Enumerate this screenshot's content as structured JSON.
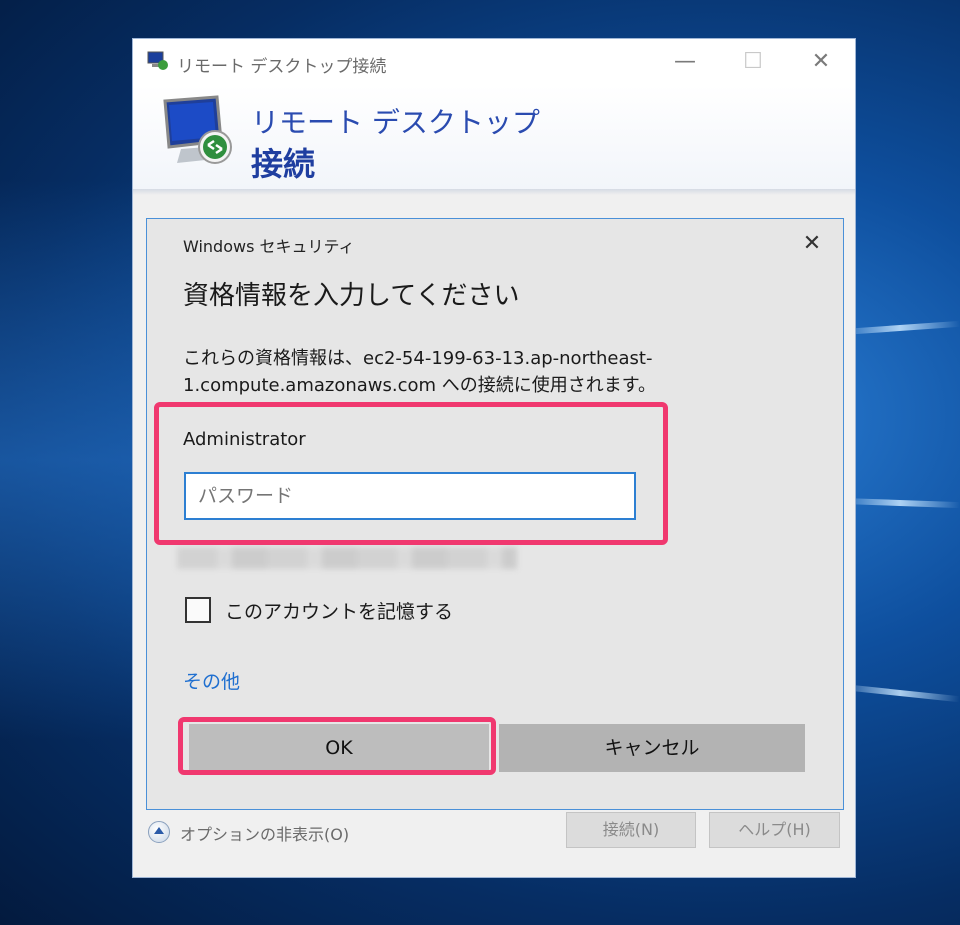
{
  "window": {
    "title": "リモート デスクトップ接続",
    "controls": {
      "minimize": "—",
      "maximize": "☐",
      "close": "✕"
    }
  },
  "banner": {
    "line1": "リモート デスクトップ",
    "line2": "接続"
  },
  "security_dialog": {
    "title": "Windows セキュリティ",
    "close": "✕",
    "heading": "資格情報を入力してください",
    "description": "これらの資格情報は、ec2-54-199-63-13.ap-northeast-1.compute.amazonaws.com への接続に使用されます。",
    "username": "Administrator",
    "password_placeholder": "パスワード",
    "remember_label": "このアカウントを記憶する",
    "more_link": "その他",
    "ok_label": "OK",
    "cancel_label": "キャンセル"
  },
  "footer": {
    "options_label": "オプションの非表示(O)",
    "connect_label": "接続(N)",
    "help_label": "ヘルプ(H)"
  },
  "colors": {
    "highlight": "#f0386f",
    "link": "#1f6fd0",
    "banner_text": "#2a4bb0",
    "focus_border": "#2d7fd2"
  }
}
